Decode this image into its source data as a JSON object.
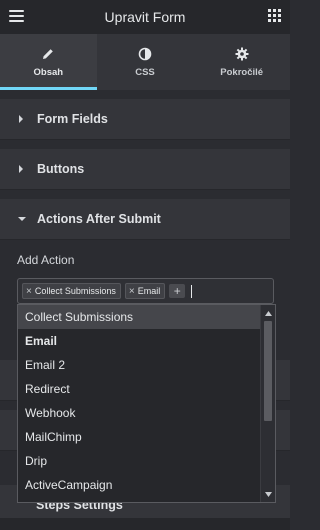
{
  "header": {
    "title": "Upravit Form",
    "menu_icon": "hamburger-icon",
    "apps_icon": "grid-icon"
  },
  "tabs": [
    {
      "label": "Obsah",
      "icon": "pencil-icon",
      "active": true
    },
    {
      "label": "CSS",
      "icon": "contrast-icon",
      "active": false
    },
    {
      "label": "Pokročilé",
      "icon": "gear-icon",
      "active": false
    }
  ],
  "sections": [
    {
      "label": "Form Fields",
      "expanded": false
    },
    {
      "label": "Buttons",
      "expanded": false
    },
    {
      "label": "Actions After Submit",
      "expanded": true
    }
  ],
  "actions": {
    "add_action_label": "Add Action",
    "selected": [
      "Collect Submissions",
      "Email"
    ],
    "remove_symbol": "×",
    "add_symbol": "+"
  },
  "dropdown": {
    "options": [
      "Collect Submissions",
      "Email",
      "Email 2",
      "Redirect",
      "Webhook",
      "MailChimp",
      "Drip",
      "ActiveCampaign"
    ],
    "highlighted": "Collect Submissions"
  },
  "hidden_sections": [
    {
      "label": "Steps Settings"
    }
  ],
  "colors": {
    "accent": "#71d7f7",
    "panel": "#34353a",
    "background": "#2b2c31"
  }
}
